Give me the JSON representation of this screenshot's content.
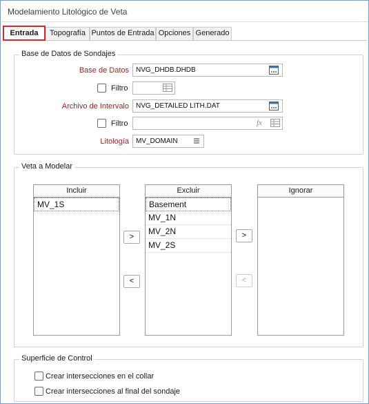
{
  "window": {
    "title": "Modelamiento Litológico de Veta"
  },
  "tabs": [
    {
      "label": "Entrada",
      "active": true
    },
    {
      "label": "Topografía"
    },
    {
      "label": "Puntos de Entrada"
    },
    {
      "label": "Opciones"
    },
    {
      "label": "Generado"
    }
  ],
  "drillhole_db": {
    "legend": "Base de Datos de Sondajes",
    "database_label": "Base de Datos",
    "database_value": "NVG_DHDB.DHDB",
    "filter1_label": "Filtro",
    "filter1_value": "",
    "interval_label": "Archivo de Intervalo",
    "interval_value": "NVG_DETAILED LITH.DAT",
    "filter2_label": "Filtro",
    "filter2_value": "",
    "formula_icon": "fx",
    "lithology_label": "Litología",
    "lithology_value": "MV_DOMAIN"
  },
  "vein": {
    "legend": "Veta a Modelar",
    "include": {
      "header": "Incluir",
      "items": [
        "MV_1S"
      ]
    },
    "exclude": {
      "header": "Excluir",
      "items": [
        "Basement",
        "MV_1N",
        "MV_2N",
        "MV_2S"
      ]
    },
    "ignore": {
      "header": "Ignorar",
      "items": []
    },
    "btn_to_exclude": ">",
    "btn_to_include": "<",
    "btn_to_ignore": ">",
    "btn_from_ignore": "<"
  },
  "control_surface": {
    "legend": "Superficie de Control",
    "opt1": "Crear intersecciones en el collar",
    "opt2": "Crear intersecciones al final del sondaje"
  },
  "colors": {
    "active_tab_border": "#d9262c",
    "required_label": "#9c1f1f",
    "window_border": "#7a9cc6"
  }
}
